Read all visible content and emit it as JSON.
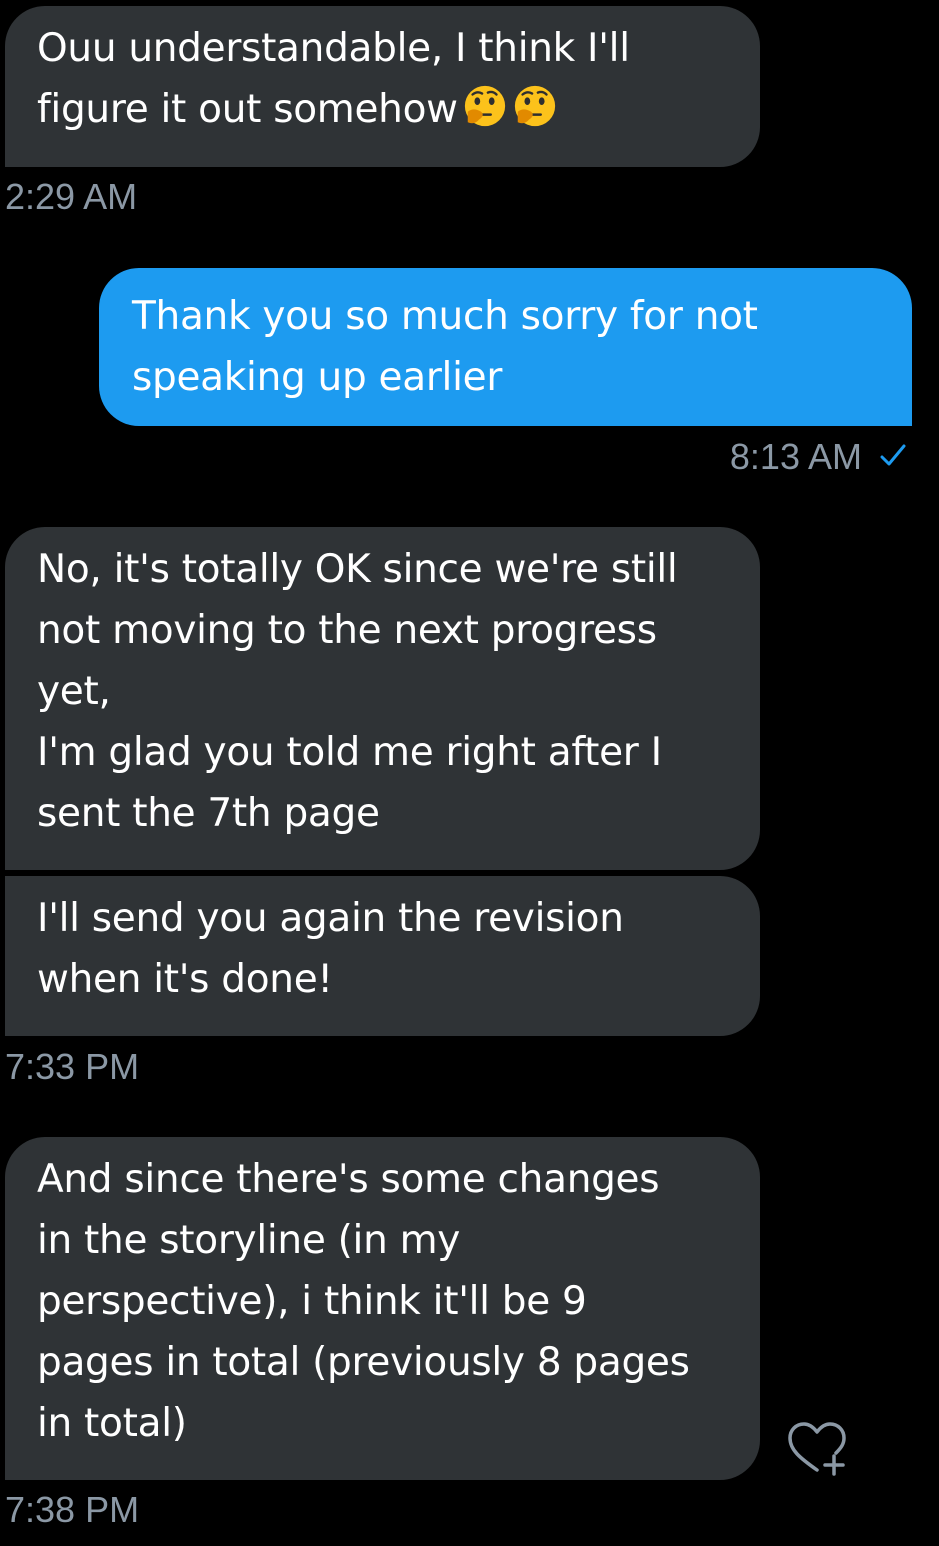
{
  "messages": [
    {
      "direction": "incoming",
      "text": "Ouu understandable, I think I'll\nfigure it out somehow",
      "emoji": [
        "thinking-face-icon",
        "thinking-face-icon"
      ]
    },
    {
      "direction": "outgoing",
      "text": "Thank you so much sorry for not\nspeaking up earlier"
    },
    {
      "direction": "incoming",
      "text": "No, it's totally OK since we're still\nnot moving to the next progress\nyet,\nI'm glad you told me right after I\nsent the 7th page"
    },
    {
      "direction": "incoming",
      "text": "I'll send you again the revision\nwhen it's done!"
    },
    {
      "direction": "incoming",
      "text": "And since there's some changes\nin the storyline (in my\nperspective), i think it'll be 9\npages in total (previously 8 pages\nin total)"
    }
  ],
  "timestamps": [
    "2:29 AM",
    "8:13 AM",
    "7:33 PM",
    "7:38 PM"
  ],
  "icons": {
    "read_receipt": "checkmark-icon",
    "react": "heart-plus-icon"
  },
  "colors": {
    "background": "#000000",
    "incoming_bubble": "#2f3336",
    "outgoing_bubble": "#1d9bf0",
    "timestamp": "#8b98a5",
    "accent": "#1d9bf0"
  }
}
